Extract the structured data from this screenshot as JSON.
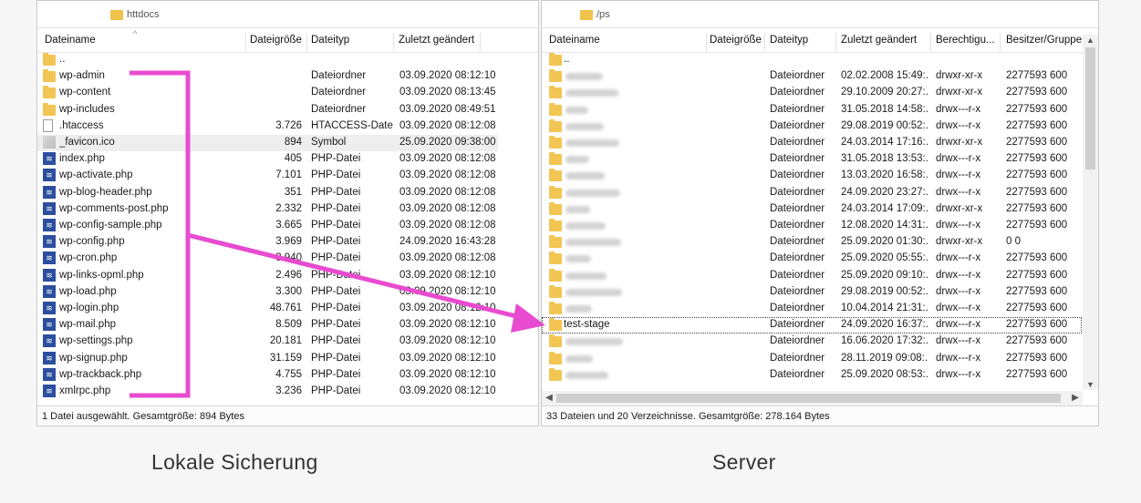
{
  "left": {
    "path": "httdocs",
    "columns": [
      "Dateiname",
      "Dateigröße",
      "Dateityp",
      "Zuletzt geändert"
    ],
    "rows": [
      {
        "name": "..",
        "size": "",
        "type": "",
        "modified": "",
        "icon": "folder-icon"
      },
      {
        "name": "wp-admin",
        "size": "",
        "type": "Dateiordner",
        "modified": "03.09.2020 08:12:10",
        "icon": "folder-icon"
      },
      {
        "name": "wp-content",
        "size": "",
        "type": "Dateiordner",
        "modified": "03.09.2020 08:13:45",
        "icon": "folder-icon"
      },
      {
        "name": "wp-includes",
        "size": "",
        "type": "Dateiordner",
        "modified": "03.09.2020 08:49:51",
        "icon": "folder-icon"
      },
      {
        "name": ".htaccess",
        "size": "3.726",
        "type": "HTACCESS-Datei",
        "modified": "03.09.2020 08:12:08",
        "icon": "file-icon"
      },
      {
        "name": "_favicon.ico",
        "size": "894",
        "type": "Symbol",
        "modified": "25.09.2020 09:38:00",
        "icon": "image-icon",
        "selected": true
      },
      {
        "name": "index.php",
        "size": "405",
        "type": "PHP-Datei",
        "modified": "03.09.2020 08:12:08",
        "icon": "php-icon"
      },
      {
        "name": "wp-activate.php",
        "size": "7.101",
        "type": "PHP-Datei",
        "modified": "03.09.2020 08:12:08",
        "icon": "php-icon"
      },
      {
        "name": "wp-blog-header.php",
        "size": "351",
        "type": "PHP-Datei",
        "modified": "03.09.2020 08:12:08",
        "icon": "php-icon"
      },
      {
        "name": "wp-comments-post.php",
        "size": "2.332",
        "type": "PHP-Datei",
        "modified": "03.09.2020 08:12:08",
        "icon": "php-icon"
      },
      {
        "name": "wp-config-sample.php",
        "size": "3.665",
        "type": "PHP-Datei",
        "modified": "03.09.2020 08:12:08",
        "icon": "php-icon"
      },
      {
        "name": "wp-config.php",
        "size": "3.969",
        "type": "PHP-Datei",
        "modified": "24.09.2020 16:43:28",
        "icon": "php-icon"
      },
      {
        "name": "wp-cron.php",
        "size": "3.940",
        "type": "PHP-Datei",
        "modified": "03.09.2020 08:12:08",
        "icon": "php-icon"
      },
      {
        "name": "wp-links-opml.php",
        "size": "2.496",
        "type": "PHP-Datei",
        "modified": "03.09.2020 08:12:10",
        "icon": "php-icon"
      },
      {
        "name": "wp-load.php",
        "size": "3.300",
        "type": "PHP-Datei",
        "modified": "03.09.2020 08:12:10",
        "icon": "php-icon"
      },
      {
        "name": "wp-login.php",
        "size": "48.761",
        "type": "PHP-Datei",
        "modified": "03.09.2020 08:12:10",
        "icon": "php-icon"
      },
      {
        "name": "wp-mail.php",
        "size": "8.509",
        "type": "PHP-Datei",
        "modified": "03.09.2020 08:12:10",
        "icon": "php-icon"
      },
      {
        "name": "wp-settings.php",
        "size": "20.181",
        "type": "PHP-Datei",
        "modified": "03.09.2020 08:12:10",
        "icon": "php-icon"
      },
      {
        "name": "wp-signup.php",
        "size": "31.159",
        "type": "PHP-Datei",
        "modified": "03.09.2020 08:12:10",
        "icon": "php-icon"
      },
      {
        "name": "wp-trackback.php",
        "size": "4.755",
        "type": "PHP-Datei",
        "modified": "03.09.2020 08:12:10",
        "icon": "php-icon"
      },
      {
        "name": "xmlrpc.php",
        "size": "3.236",
        "type": "PHP-Datei",
        "modified": "03.09.2020 08:12:10",
        "icon": "php-icon"
      }
    ],
    "status": "1 Datei ausgewählt. Gesamtgröße: 894 Bytes"
  },
  "right": {
    "path": "/ps",
    "columns": [
      "Dateiname",
      "Dateigröße",
      "Dateityp",
      "Zuletzt geändert",
      "Berechtigu...",
      "Besitzer/Gruppe"
    ],
    "rows": [
      {
        "name": "..",
        "type": "",
        "modified": "",
        "perms": "",
        "owner": "",
        "blurred": false
      },
      {
        "name": "",
        "type": "Dateiordner",
        "modified": "02.02.2008 15:49:...",
        "perms": "drwxr-xr-x",
        "owner": "2277593 600",
        "blurred": true
      },
      {
        "name": "",
        "type": "Dateiordner",
        "modified": "29.10.2009 20:27:...",
        "perms": "drwxr-xr-x",
        "owner": "2277593 600",
        "blurred": true
      },
      {
        "name": "",
        "type": "Dateiordner",
        "modified": "31.05.2018 14:58:...",
        "perms": "drwx---r-x",
        "owner": "2277593 600",
        "blurred": true
      },
      {
        "name": "",
        "type": "Dateiordner",
        "modified": "29.08.2019 00:52:...",
        "perms": "drwx---r-x",
        "owner": "2277593 600",
        "blurred": true
      },
      {
        "name": "",
        "type": "Dateiordner",
        "modified": "24.03.2014 17:16:...",
        "perms": "drwxr-xr-x",
        "owner": "2277593 600",
        "blurred": true
      },
      {
        "name": "",
        "type": "Dateiordner",
        "modified": "31.05.2018 13:53:...",
        "perms": "drwx---r-x",
        "owner": "2277593 600",
        "blurred": true
      },
      {
        "name": "",
        "type": "Dateiordner",
        "modified": "13.03.2020 16:58:...",
        "perms": "drwx---r-x",
        "owner": "2277593 600",
        "blurred": true
      },
      {
        "name": "",
        "type": "Dateiordner",
        "modified": "24.09.2020 23:27:...",
        "perms": "drwx---r-x",
        "owner": "2277593 600",
        "blurred": true
      },
      {
        "name": "",
        "type": "Dateiordner",
        "modified": "24.03.2014 17:09:...",
        "perms": "drwxr-xr-x",
        "owner": "2277593 600",
        "blurred": true
      },
      {
        "name": "",
        "type": "Dateiordner",
        "modified": "12.08.2020 14:31:...",
        "perms": "drwx---r-x",
        "owner": "2277593 600",
        "blurred": true
      },
      {
        "name": "",
        "type": "Dateiordner",
        "modified": "25.09.2020 01:30:...",
        "perms": "drwxr-xr-x",
        "owner": "0 0",
        "blurred": true
      },
      {
        "name": "",
        "type": "Dateiordner",
        "modified": "25.09.2020 05:55:...",
        "perms": "drwx---r-x",
        "owner": "2277593 600",
        "blurred": true
      },
      {
        "name": "",
        "type": "Dateiordner",
        "modified": "25.09.2020 09:10:...",
        "perms": "drwx---r-x",
        "owner": "2277593 600",
        "blurred": true
      },
      {
        "name": "",
        "type": "Dateiordner",
        "modified": "29.08.2019 00:52:...",
        "perms": "drwx---r-x",
        "owner": "2277593 600",
        "blurred": true
      },
      {
        "name": "",
        "type": "Dateiordner",
        "modified": "10.04.2014 21:31:...",
        "perms": "drwx---r-x",
        "owner": "2277593 600",
        "blurred": true
      },
      {
        "name": "test-stage",
        "type": "Dateiordner",
        "modified": "24.09.2020 16:37:...",
        "perms": "drwx---r-x",
        "owner": "2277593 600",
        "blurred": false,
        "focused": true
      },
      {
        "name": "",
        "type": "Dateiordner",
        "modified": "16.06.2020 17:32:...",
        "perms": "drwx---r-x",
        "owner": "2277593 600",
        "blurred": true
      },
      {
        "name": "",
        "type": "Dateiordner",
        "modified": "28.11.2019 09:08:...",
        "perms": "drwx---r-x",
        "owner": "2277593 600",
        "blurred": true
      },
      {
        "name": "",
        "type": "Dateiordner",
        "modified": "25.09.2020 08:53:...",
        "perms": "drwx---r-x",
        "owner": "2277593 600",
        "blurred": true
      }
    ],
    "status": "33 Dateien und 20 Verzeichnisse. Gesamtgröße: 278.164 Bytes"
  },
  "captions": {
    "left": "Lokale Sicherung",
    "right": "Server"
  },
  "colors": {
    "annotation": "#e84bd0",
    "folder": "#f3c553",
    "php": "#2b4f9e"
  }
}
